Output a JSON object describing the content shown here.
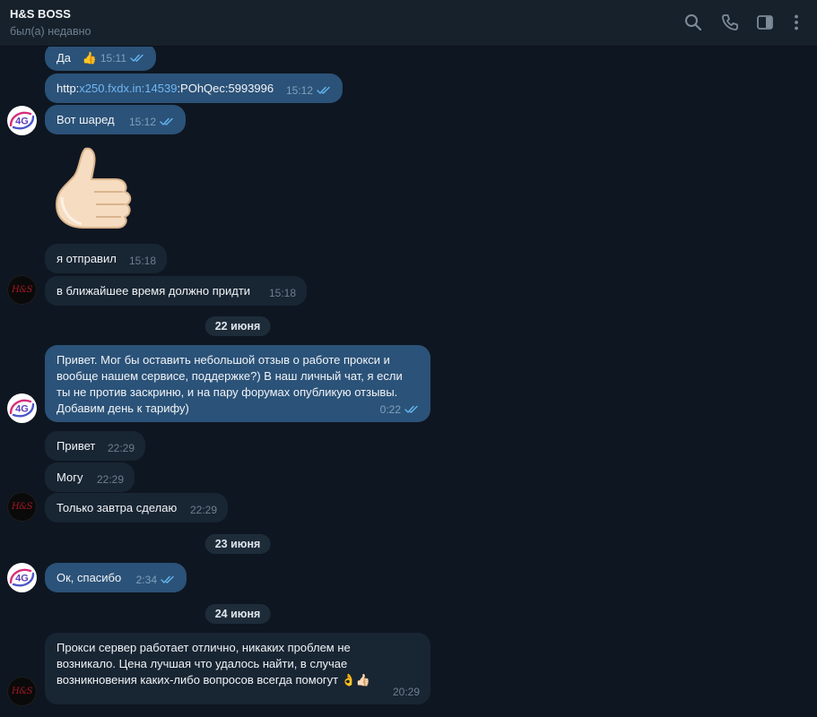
{
  "header": {
    "title": "H&S BOSS",
    "status": "был(а) недавно",
    "icons": [
      "search-icon",
      "phone-icon",
      "sidebar-icon",
      "more-icon"
    ]
  },
  "colors": {
    "background": "#0e1621",
    "header_bg": "#17212b",
    "outgoing_bubble": "#2b5278",
    "incoming_bubble": "#182533",
    "link": "#71b7f4",
    "read_check": "#64b5ef"
  },
  "messages": {
    "m1": {
      "text": "Да",
      "emoji": "👍",
      "time": "15:11"
    },
    "m2": {
      "text_prefix": "http:",
      "link": "x250.fxdx.in:14539",
      "text_suffix": ":POhQec:5993996",
      "time": "15:12"
    },
    "m3": {
      "text": "Вот шаред",
      "time": "15:12"
    },
    "sticker": {
      "icon": "thumbs-up-sticker"
    },
    "m4": {
      "text": "я отправил",
      "time": "15:18"
    },
    "m5": {
      "text": "в ближайшее время должно придти",
      "time": "15:18"
    },
    "date1": "22 июня",
    "m6": {
      "text": "Привет. Мог бы оставить небольшой отзыв о работе прокси и\nвообще нашем сервисе, поддержке?) В наш личный чат, я если\nты не против заскриню, и на пару форумах опубликую отзывы.\nДобавим день к тарифу)",
      "time": "0:22"
    },
    "m7": {
      "text": "Привет",
      "time": "22:29"
    },
    "m8": {
      "text": "Могу",
      "time": "22:29"
    },
    "m9": {
      "text": "Только завтра сделаю",
      "time": "22:29"
    },
    "date2": "23 июня",
    "m10": {
      "text": "Ок, спасибо",
      "time": "2:34"
    },
    "date3": "24 июня",
    "m11": {
      "text": "Прокси сервер работает отлично, никаких проблем не\nвозникало. Цена лучшая что удалось найти, в случае\nвозникновения каких-либо вопросов всегда помогут ",
      "emoji": "👌👍🏻",
      "time": "20:29"
    }
  },
  "avatars": {
    "outgoing": "4G",
    "incoming": "H&S"
  }
}
